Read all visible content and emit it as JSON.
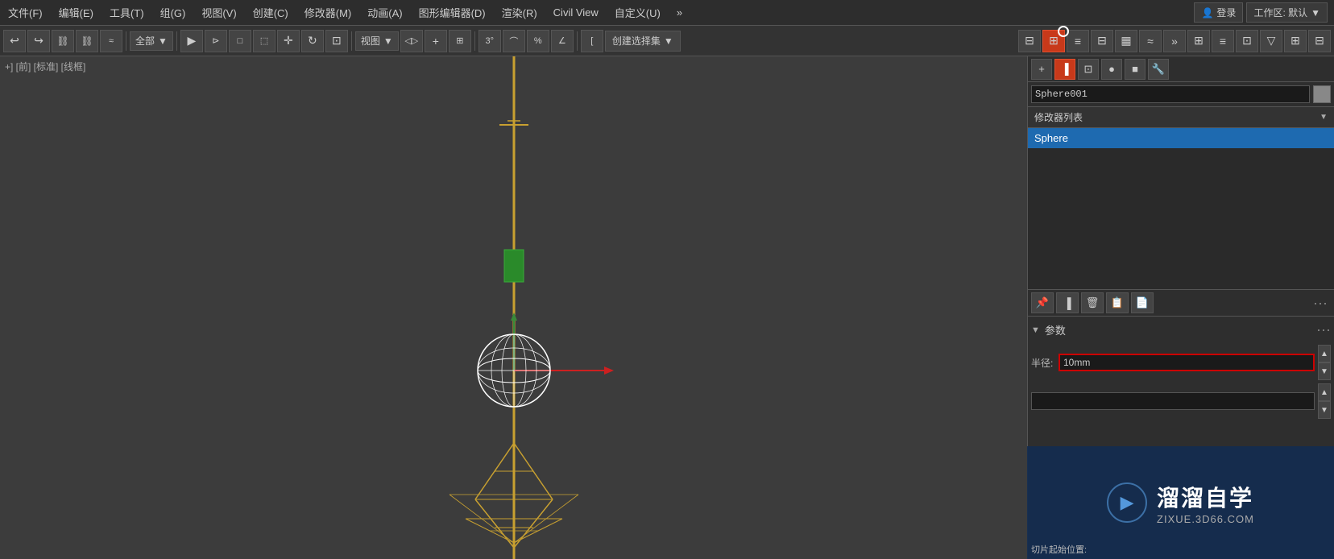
{
  "menu": {
    "items": [
      {
        "label": "文件(F)"
      },
      {
        "label": "编辑(E)"
      },
      {
        "label": "工具(T)"
      },
      {
        "label": "组(G)"
      },
      {
        "label": "视图(V)"
      },
      {
        "label": "创建(C)"
      },
      {
        "label": "修改器(M)"
      },
      {
        "label": "动画(A)"
      },
      {
        "label": "图形编辑器(D)"
      },
      {
        "label": "渲染(R)"
      },
      {
        "label": "Civil View"
      },
      {
        "label": "自定义(U)"
      },
      {
        "label": "»"
      }
    ],
    "login_label": "登录",
    "workspace_prefix": "工作区: 默认"
  },
  "toolbar": {
    "undo_label": "↩",
    "redo_label": "↪",
    "link_label": "🔗",
    "unlink_label": "🔗",
    "bind_label": "~",
    "scope_label": "全部",
    "select_label": "▶",
    "select2_label": "▷",
    "rect_label": "□",
    "rect2_label": "□",
    "move_label": "✛",
    "rotate_label": "↻",
    "view_label": "视图",
    "mirror_label": "◁▷",
    "plus_label": "+",
    "align_label": "⊞",
    "angle3_label": "3°",
    "arc_label": "⌒",
    "percent_label": "%",
    "angle2_label": "∠",
    "bracket_label": "[",
    "create_sel_label": "创建选择集",
    "create_sel_dropdown": "▼",
    "extra_label": "»"
  },
  "toolbar2": {
    "icons": [
      "▦",
      "≡",
      "⊟",
      "●",
      "■",
      "🔧"
    ]
  },
  "viewport": {
    "label": "+] [前] [标准] [线框]"
  },
  "right_panel": {
    "panel_buttons": [
      "+",
      "⊞",
      "⊡",
      "●",
      "■",
      "🔧"
    ],
    "object_name": "Sphere001",
    "modifier_list_label": "修改器列表",
    "modifier_list_expand": "▼",
    "modifiers": [
      {
        "label": "Sphere",
        "selected": true
      }
    ],
    "mod_toolbar_icons": [
      "✏",
      "▐",
      "🗑",
      "📋"
    ],
    "params_label": "参数",
    "params_expand": "▼",
    "radius_label": "半径:",
    "radius_value": "10mm",
    "slice_start_label": "切片起始位置:",
    "slice_start_value": ""
  },
  "watermark": {
    "logo_icon": "▶",
    "title": "溜溜自学",
    "url": "ZIXUE.3D66.COM"
  },
  "colors": {
    "active_red": "#c8391a",
    "selection_blue": "#1e6ab0",
    "background": "#3c3c3c",
    "panel_bg": "#2e2e2e"
  }
}
